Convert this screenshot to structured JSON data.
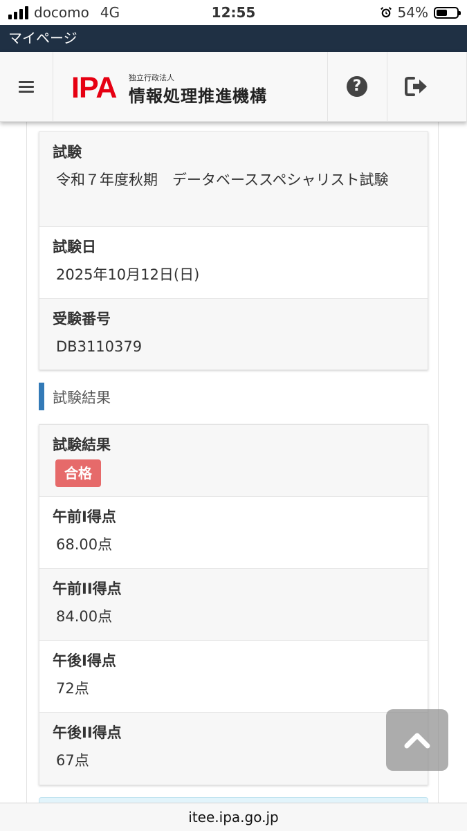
{
  "status_bar": {
    "carrier": "docomo",
    "network": "4G",
    "time": "12:55",
    "battery_percent": "54%",
    "battery_level": 0.54,
    "signal_bars": 4
  },
  "title_bar": {
    "title": "マイページ"
  },
  "header": {
    "logo_mark": "IPA",
    "logo_subtitle": "独立行政法人",
    "logo_org": "情報処理推進機構",
    "icons": [
      "menu-icon",
      "help-icon",
      "logout-icon"
    ],
    "brand_color": "#e60012"
  },
  "exam_info": [
    {
      "label": "試験",
      "value": "令和７年度秋期　データベーススペシャリスト試験"
    },
    {
      "label": "試験日",
      "value": "2025年10月12日(日)"
    },
    {
      "label": "受験番号",
      "value": "DB3110379"
    }
  ],
  "results_section": {
    "heading": "試験結果",
    "result_label": "試験結果",
    "result_badge": "合格",
    "badge_color": "#e66a6a",
    "scores": [
      {
        "label": "午前I得点",
        "value": "68.00点"
      },
      {
        "label": "午前II得点",
        "value": "84.00点"
      },
      {
        "label": "午後I得点",
        "value": "72点"
      },
      {
        "label": "午後II得点",
        "value": "67点"
      }
    ]
  },
  "scroll_top": {
    "icon": "chevron-up-icon"
  },
  "browser": {
    "url": "itee.ipa.go.jp"
  }
}
